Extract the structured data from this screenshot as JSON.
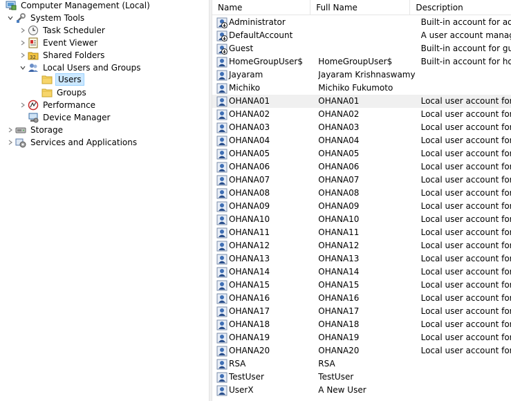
{
  "tree": {
    "root": "Computer Management (Local)",
    "system_tools": "System Tools",
    "task_scheduler": "Task Scheduler",
    "event_viewer": "Event Viewer",
    "shared_folders": "Shared Folders",
    "local_users_groups": "Local Users and Groups",
    "users": "Users",
    "groups": "Groups",
    "performance": "Performance",
    "device_manager": "Device Manager",
    "storage": "Storage",
    "services_apps": "Services and Applications"
  },
  "list": {
    "columns": {
      "name": "Name",
      "full_name": "Full Name",
      "description": "Description"
    },
    "rows": [
      {
        "name": "Administrator",
        "full": "",
        "desc": "Built-in account for administering the computer/domain",
        "icon": "disabled-user-icon"
      },
      {
        "name": "DefaultAccount",
        "full": "",
        "desc": "A user account managed by the system.",
        "icon": "disabled-user-icon"
      },
      {
        "name": "Guest",
        "full": "",
        "desc": "Built-in account for guest access to the computer/domain",
        "icon": "disabled-user-icon"
      },
      {
        "name": "HomeGroupUser$",
        "full": "HomeGroupUser$",
        "desc": "Built-in account for homegroup access to the computer",
        "icon": "user-icon"
      },
      {
        "name": "Jayaram",
        "full": "Jayaram Krishnaswamy",
        "desc": "",
        "icon": "user-icon"
      },
      {
        "name": "Michiko",
        "full": "Michiko Fukumoto",
        "desc": "",
        "icon": "user-icon"
      },
      {
        "name": "OHANA01",
        "full": "OHANA01",
        "desc": "Local user account for employee",
        "icon": "user-icon"
      },
      {
        "name": "OHANA02",
        "full": "OHANA02",
        "desc": "Local user account for employee",
        "icon": "user-icon"
      },
      {
        "name": "OHANA03",
        "full": "OHANA03",
        "desc": "Local user account for employee",
        "icon": "user-icon"
      },
      {
        "name": "OHANA04",
        "full": "OHANA04",
        "desc": "Local user account for employee",
        "icon": "user-icon"
      },
      {
        "name": "OHANA05",
        "full": "OHANA05",
        "desc": "Local user account for employee",
        "icon": "user-icon"
      },
      {
        "name": "OHANA06",
        "full": "OHANA06",
        "desc": "Local user account for employee",
        "icon": "user-icon"
      },
      {
        "name": "OHANA07",
        "full": "OHANA07",
        "desc": "Local user account for employee",
        "icon": "user-icon"
      },
      {
        "name": "OHANA08",
        "full": "OHANA08",
        "desc": "Local user account for employee",
        "icon": "user-icon"
      },
      {
        "name": "OHANA09",
        "full": "OHANA09",
        "desc": "Local user account for employee",
        "icon": "user-icon"
      },
      {
        "name": "OHANA10",
        "full": "OHANA10",
        "desc": "Local user account for employee",
        "icon": "user-icon"
      },
      {
        "name": "OHANA11",
        "full": "OHANA11",
        "desc": "Local user account for employee",
        "icon": "user-icon"
      },
      {
        "name": "OHANA12",
        "full": "OHANA12",
        "desc": "Local user account for employee",
        "icon": "user-icon"
      },
      {
        "name": "OHANA13",
        "full": "OHANA13",
        "desc": "Local user account for employee",
        "icon": "user-icon"
      },
      {
        "name": "OHANA14",
        "full": "OHANA14",
        "desc": "Local user account for employee",
        "icon": "user-icon"
      },
      {
        "name": "OHANA15",
        "full": "OHANA15",
        "desc": "Local user account for employee",
        "icon": "user-icon"
      },
      {
        "name": "OHANA16",
        "full": "OHANA16",
        "desc": "Local user account for employee",
        "icon": "user-icon"
      },
      {
        "name": "OHANA17",
        "full": "OHANA17",
        "desc": "Local user account for employee",
        "icon": "user-icon"
      },
      {
        "name": "OHANA18",
        "full": "OHANA18",
        "desc": "Local user account for employee",
        "icon": "user-icon"
      },
      {
        "name": "OHANA19",
        "full": "OHANA19",
        "desc": "Local user account for employee",
        "icon": "user-icon"
      },
      {
        "name": "OHANA20",
        "full": "OHANA20",
        "desc": "Local user account for employee",
        "icon": "user-icon"
      },
      {
        "name": "RSA",
        "full": "RSA",
        "desc": "",
        "icon": "user-icon"
      },
      {
        "name": "TestUser",
        "full": "TestUser",
        "desc": "",
        "icon": "user-icon"
      },
      {
        "name": "UserX",
        "full": "A New User",
        "desc": "",
        "icon": "user-icon"
      }
    ]
  }
}
